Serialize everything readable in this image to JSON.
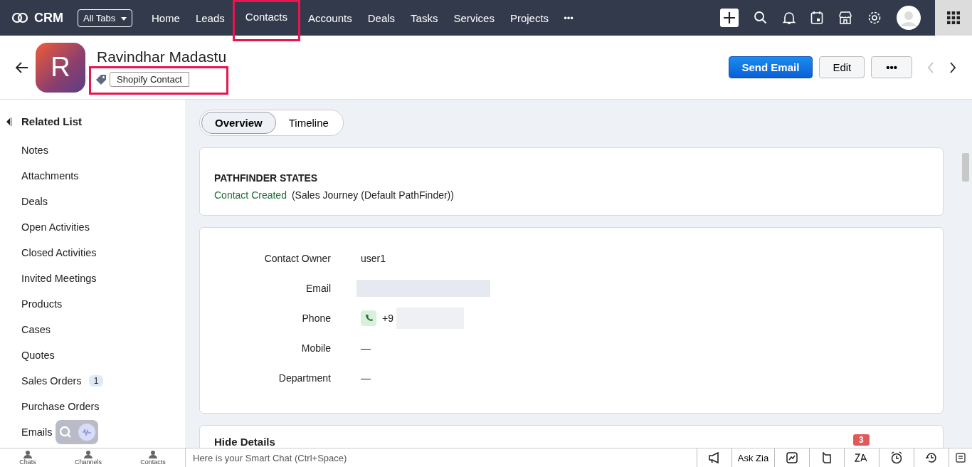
{
  "topbar": {
    "logo": "CRM",
    "all_tabs": "All Tabs",
    "nav": [
      {
        "label": "Home",
        "selected": false,
        "highlighted": false
      },
      {
        "label": "Leads",
        "selected": false,
        "highlighted": false
      },
      {
        "label": "Contacts",
        "selected": true,
        "highlighted": true
      },
      {
        "label": "Accounts",
        "selected": false,
        "highlighted": false
      },
      {
        "label": "Deals",
        "selected": false,
        "highlighted": false
      },
      {
        "label": "Tasks",
        "selected": false,
        "highlighted": false
      },
      {
        "label": "Services",
        "selected": false,
        "highlighted": false
      },
      {
        "label": "Projects",
        "selected": false,
        "highlighted": false
      }
    ],
    "more": "•••"
  },
  "record": {
    "initial": "R",
    "name": "Ravindhar Madastu",
    "tag": {
      "label": "Shopify Contact",
      "highlighted": true
    },
    "buttons": {
      "send_email": "Send Email",
      "edit": "Edit",
      "more": "•••"
    }
  },
  "sidebar": {
    "heading": "Related List",
    "items": [
      {
        "label": "Notes"
      },
      {
        "label": "Attachments"
      },
      {
        "label": "Deals"
      },
      {
        "label": "Open Activities"
      },
      {
        "label": "Closed Activities"
      },
      {
        "label": "Invited Meetings"
      },
      {
        "label": "Products"
      },
      {
        "label": "Cases"
      },
      {
        "label": "Quotes"
      },
      {
        "label": "Sales Orders",
        "count": "1"
      },
      {
        "label": "Purchase Orders"
      },
      {
        "label": "Emails"
      }
    ]
  },
  "tabs": [
    {
      "label": "Overview",
      "selected": true
    },
    {
      "label": "Timeline",
      "selected": false
    }
  ],
  "pathfinder": {
    "title": "PATHFINDER STATES",
    "state": "Contact Created",
    "journey": "(Sales Journey (Default PathFinder))"
  },
  "fields": [
    {
      "label": "Contact Owner",
      "kind": "text",
      "value": "user1"
    },
    {
      "label": "Email",
      "kind": "redacted"
    },
    {
      "label": "Phone",
      "kind": "phone",
      "value": "+9"
    },
    {
      "label": "Mobile",
      "kind": "text",
      "value": "—"
    },
    {
      "label": "Department",
      "kind": "text",
      "value": "—"
    }
  ],
  "hide_details": "Hide Details",
  "bottombar": {
    "left": [
      {
        "label": "Chats"
      },
      {
        "label": "Channels"
      },
      {
        "label": "Contacts"
      }
    ],
    "smart_chat": "Here is your Smart Chat (Ctrl+Space)",
    "ask_zia": "Ask Zia",
    "zia_badge": "3"
  }
}
